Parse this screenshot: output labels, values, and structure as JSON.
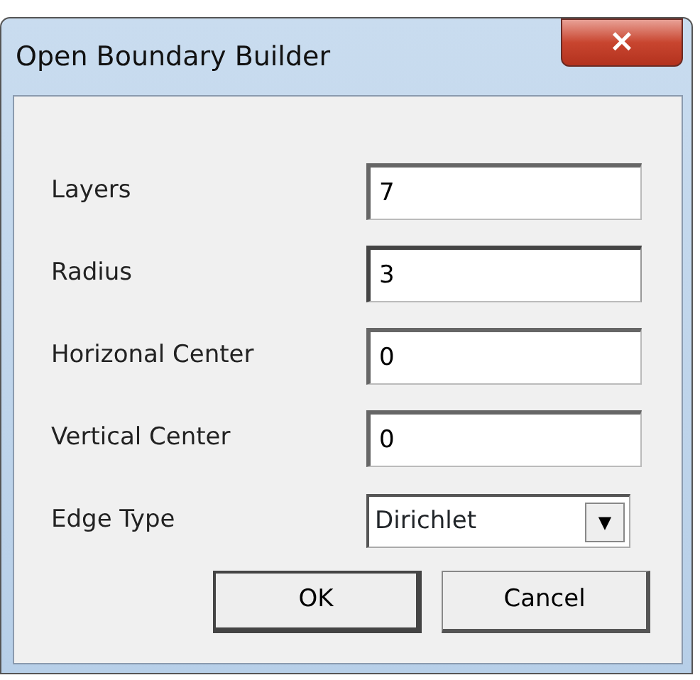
{
  "window": {
    "title": "Open Boundary Builder",
    "close_label": "×"
  },
  "fields": [
    {
      "kind": "text",
      "label": "Layers",
      "value": "7",
      "focused": false
    },
    {
      "kind": "text",
      "label": "Radius",
      "value": "3",
      "focused": true
    },
    {
      "kind": "text",
      "label": "Horizonal Center",
      "value": "0",
      "focused": false
    },
    {
      "kind": "text",
      "label": "Vertical Center",
      "value": "0",
      "focused": false
    },
    {
      "kind": "combo",
      "label": "Edge Type",
      "value": "Dirichlet",
      "arrow": "▼"
    }
  ],
  "buttons": [
    {
      "label": "OK",
      "default": true
    },
    {
      "label": "Cancel",
      "default": false
    }
  ]
}
